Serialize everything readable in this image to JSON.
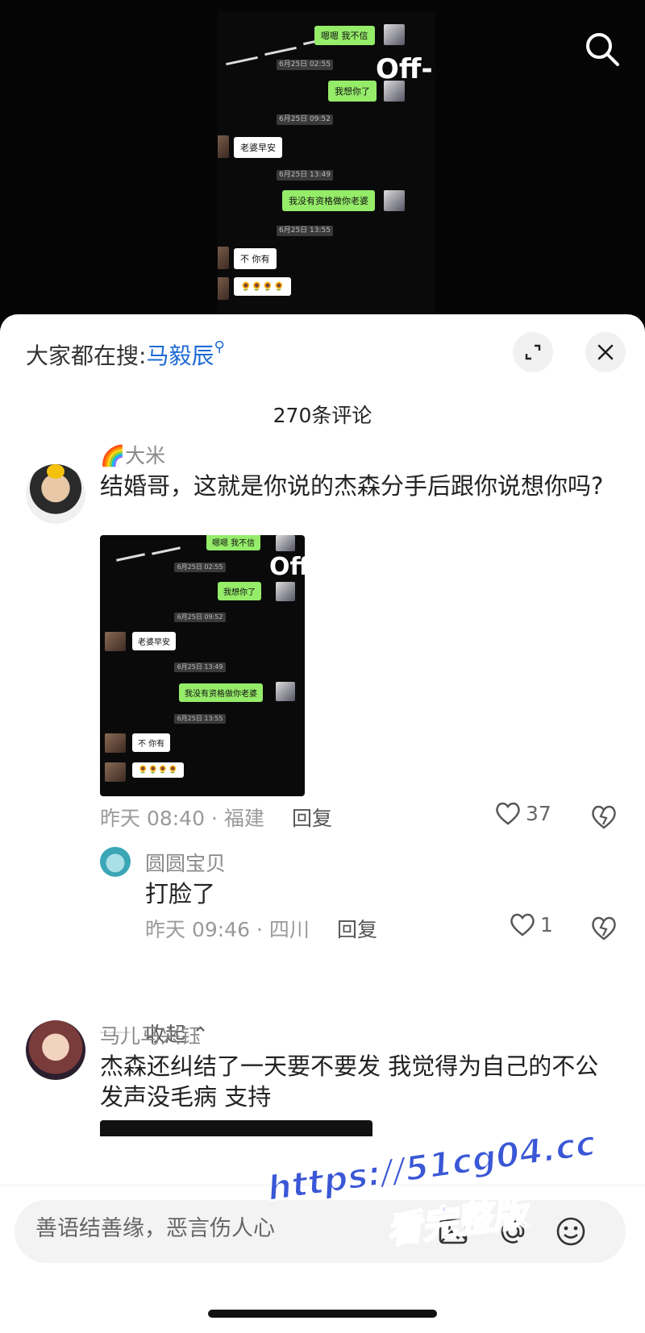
{
  "hot_search": {
    "prefix": "大家都在搜:",
    "keyword": "马毅辰"
  },
  "comments_count": "270条评论",
  "chat": {
    "m1": "嗯嗯 我不信",
    "t1": "6月25日 02:55",
    "m2": "我想你了",
    "t2": "6月25日 09:52",
    "m3": "老婆早安",
    "t3": "6月25日 13:49",
    "m4": "我没有资格做你老婆",
    "t4": "6月25日 13:55",
    "m5": "不 你有",
    "m6": "🌻🌻🌻🌻",
    "logo": "Off-"
  },
  "comments": [
    {
      "name": "🌈大米",
      "text": "结婚哥，这就是你说的杰森分手后跟你说想你吗?",
      "meta": "昨天 08:40 · 福建",
      "reply_label": "回复",
      "likes": "37",
      "replies": [
        {
          "name": "圆圆宝贝",
          "text": "打脸了",
          "meta": "昨天 09:46 · 四川",
          "reply_label": "回复",
          "likes": "1"
        }
      ],
      "collapse_label": "收起"
    },
    {
      "name": "马儿马兴钰",
      "text": "杰森还纠结了一天要不要发 我觉得为自己的不公发声没毛病 支持"
    }
  ],
  "input": {
    "placeholder": "善语结善缘，恶言伤人心"
  },
  "watermark": {
    "line1": "https://51cg04.cc",
    "line2": "看完整版"
  }
}
